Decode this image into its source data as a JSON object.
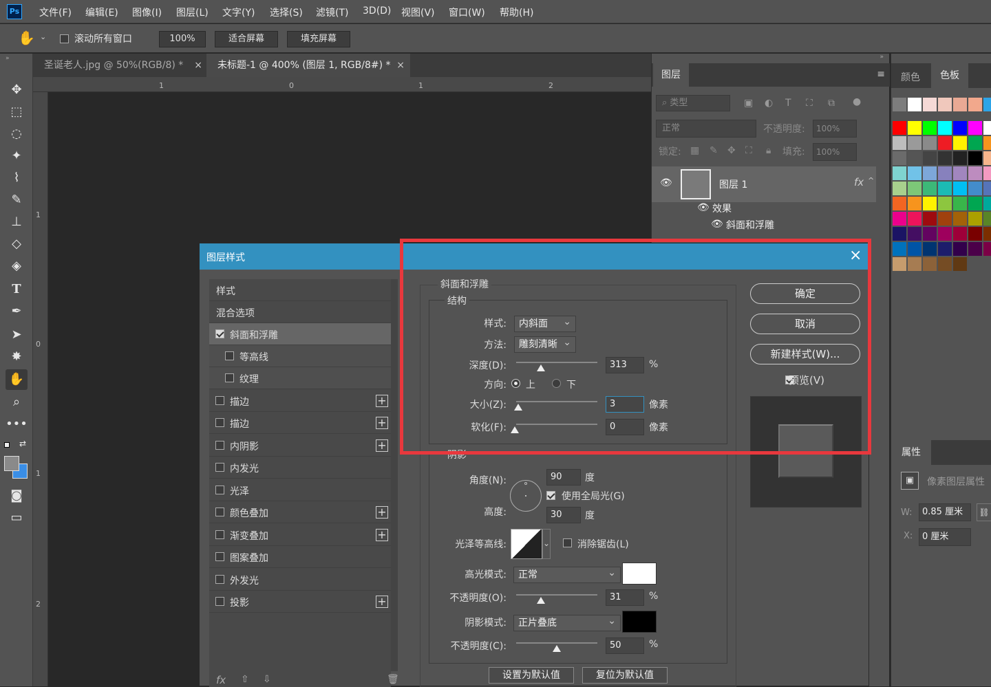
{
  "menubar": {
    "logo": "Ps",
    "items": [
      "文件(F)",
      "编辑(E)",
      "图像(I)",
      "图层(L)",
      "文字(Y)",
      "选择(S)",
      "滤镜(T)",
      "3D(D)",
      "视图(V)",
      "窗口(W)",
      "帮助(H)"
    ]
  },
  "options": {
    "scroll_all": "滚动所有窗口",
    "zoom": "100%",
    "fit_screen": "适合屏幕",
    "fill_screen": "填充屏幕"
  },
  "tabs": [
    {
      "label": "圣诞老人.jpg @ 50%(RGB/8) *",
      "close": "×"
    },
    {
      "label": "未标题-1 @ 400% (图层 1, RGB/8#) *",
      "close": "×"
    }
  ],
  "rulers": {
    "h": [
      "1",
      "0",
      "1",
      "2"
    ],
    "v": [
      "1",
      "0",
      "1",
      "2"
    ]
  },
  "layers_panel": {
    "tab": "图层",
    "filter_placeholder": "类型",
    "blend": "正常",
    "opacity_label": "不透明度:",
    "opacity": "100%",
    "lock_label": "锁定:",
    "fill_label": "填充:",
    "fill": "100%",
    "layer_name": "图层 1",
    "fx": "fx",
    "effects": "效果",
    "effect_item": "斜面和浮雕"
  },
  "swatch_panel": {
    "tab_color": "颜色",
    "tab_swatch": "色板"
  },
  "properties": {
    "tab": "属性",
    "title": "像素图层属性",
    "w_label": "W:",
    "w_value": "0.85 厘米",
    "x_label": "X:",
    "x_value": "0 厘米"
  },
  "dialog": {
    "title": "图层样式",
    "list": [
      {
        "label": "样式",
        "check": null,
        "plus": false
      },
      {
        "label": "混合选项",
        "check": null,
        "plus": false
      },
      {
        "label": "斜面和浮雕",
        "check": true,
        "plus": false
      },
      {
        "label": "等高线",
        "check": false,
        "plus": false
      },
      {
        "label": "纹理",
        "check": false,
        "plus": false
      },
      {
        "label": "描边",
        "check": false,
        "plus": true
      },
      {
        "label": "描边",
        "check": false,
        "plus": true
      },
      {
        "label": "内阴影",
        "check": false,
        "plus": true
      },
      {
        "label": "内发光",
        "check": false,
        "plus": false
      },
      {
        "label": "光泽",
        "check": false,
        "plus": false
      },
      {
        "label": "颜色叠加",
        "check": false,
        "plus": true
      },
      {
        "label": "渐变叠加",
        "check": false,
        "plus": true
      },
      {
        "label": "图案叠加",
        "check": false,
        "plus": false
      },
      {
        "label": "外发光",
        "check": false,
        "plus": false
      },
      {
        "label": "投影",
        "check": false,
        "plus": true
      }
    ],
    "footer_fx": "fx",
    "bevel": {
      "group": "斜面和浮雕",
      "structure": "结构",
      "style_label": "样式:",
      "style_value": "内斜面",
      "technique_label": "方法:",
      "technique_value": "雕刻清晰",
      "depth_label": "深度(D):",
      "depth_value": "313",
      "depth_unit": "%",
      "depth_frac": 0.31,
      "direction_label": "方向:",
      "dir_up": "上",
      "dir_down": "下",
      "size_label": "大小(Z):",
      "size_value": "3",
      "size_unit": "像素",
      "size_frac": 0.02,
      "soften_label": "软化(F):",
      "soften_value": "0",
      "soften_unit": "像素",
      "soften_frac": 0.0
    },
    "shading": {
      "group": "阴影",
      "angle_label": "角度(N):",
      "angle_value": "90",
      "angle_unit": "度",
      "global_light": "使用全局光(G)",
      "altitude_label": "高度:",
      "altitude_value": "30",
      "altitude_unit": "度",
      "gloss_label": "光泽等高线:",
      "anti_alias": "消除锯齿(L)",
      "highlight_label": "高光模式:",
      "highlight_value": "正常",
      "highlight_color": "#ffffff",
      "hl_opacity_label": "不透明度(O):",
      "hl_opacity_value": "31",
      "hl_unit": "%",
      "hl_frac": 0.31,
      "shadow_label": "阴影模式:",
      "shadow_value": "正片叠底",
      "shadow_color": "#000000",
      "sh_opacity_label": "不透明度(C):",
      "sh_opacity_value": "50",
      "sh_unit": "%",
      "sh_frac": 0.5,
      "make_default": "设置为默认值",
      "reset_default": "复位为默认值"
    },
    "buttons": {
      "ok": "确定",
      "cancel": "取消",
      "new_style": "新建样式(W)...",
      "preview": "预览(V)"
    },
    "close": "×"
  },
  "colors": {
    "highlight_box": "#e8383d",
    "title_bar": "#3391c0"
  }
}
